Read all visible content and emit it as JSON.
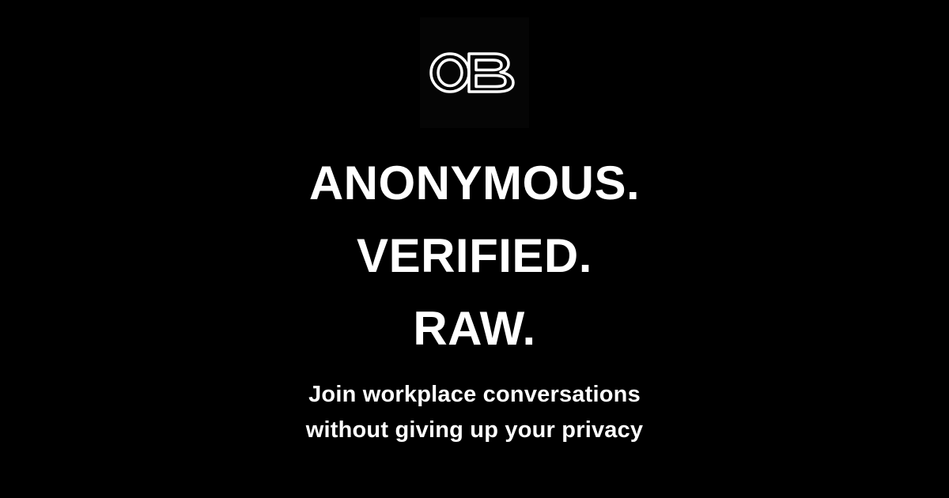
{
  "brand": {
    "logo_text": "OB",
    "logo_icon": "ob-monogram-logo"
  },
  "headline": {
    "line1": "ANONYMOUS.",
    "line2": "VERIFIED.",
    "line3": "RAW."
  },
  "tagline": {
    "line1": "Join workplace conversations",
    "line2": "without giving up your privacy"
  },
  "colors": {
    "background": "#000000",
    "text": "#ffffff",
    "logo_tile": "#050505"
  }
}
